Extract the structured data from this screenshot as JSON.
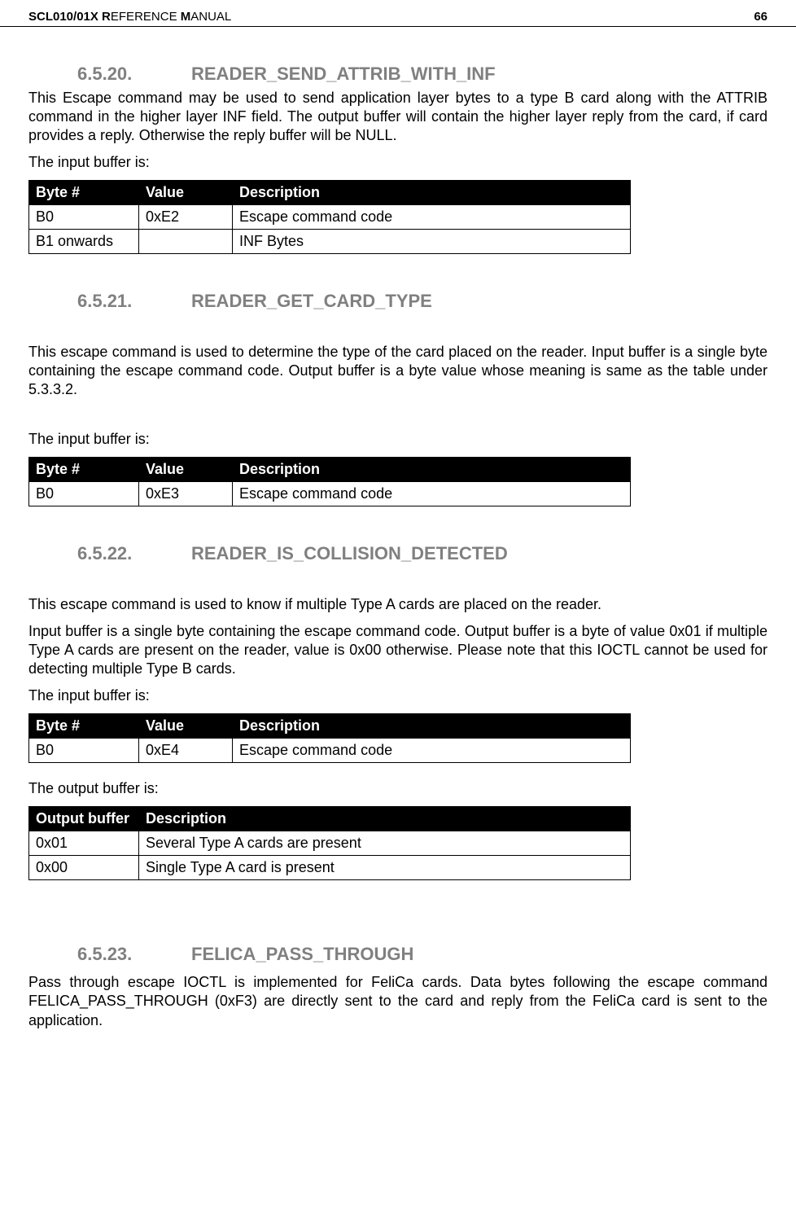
{
  "header": {
    "title_bold": "SCL010/01X R",
    "title_caps": "EFERENCE ",
    "title_bold2": "M",
    "title_caps2": "ANUAL",
    "page_no": "66"
  },
  "sections": [
    {
      "num": "6.5.20.",
      "title": "READER_SEND_ATTRIB_WITH_INF",
      "paragraphs": [
        "This Escape command may be used to send application layer bytes to a type B card along with the ATTRIB command in the higher layer INF field. The output buffer will contain the higher layer reply from the card, if card provides a reply. Otherwise the reply buffer will be NULL.",
        "The input buffer is:"
      ],
      "table": {
        "headers": [
          "Byte #",
          "Value",
          "Description"
        ],
        "rows": [
          [
            "B0",
            "0xE2",
            "Escape command code"
          ],
          [
            "B1 onwards",
            "",
            "INF Bytes"
          ]
        ]
      }
    },
    {
      "num": "6.5.21.",
      "title": "READER_GET_CARD_TYPE",
      "pre_space": true,
      "paragraphs": [
        "This escape command is used to determine the type of the card placed on the reader. Input buffer is a single byte containing the escape command code. Output buffer is a byte value whose meaning is same as the table under 5.3.3.2."
      ],
      "mid_space": true,
      "paragraphs2": [
        "The input buffer is:"
      ],
      "table": {
        "headers": [
          "Byte #",
          "Value",
          "Description"
        ],
        "rows": [
          [
            "B0",
            "0xE3",
            "Escape command code"
          ]
        ]
      }
    },
    {
      "num": "6.5.22.",
      "title": "READER_IS_COLLISION_DETECTED",
      "pre_space": true,
      "paragraphs": [
        "This escape command is used to know if multiple Type A cards are placed on the reader.",
        "Input buffer is a single byte containing the escape command code. Output buffer is a byte of value 0x01 if multiple Type A cards are present on the reader, value is 0x00 otherwise. Please note that this IOCTL cannot be used for detecting multiple Type B cards.",
        "The input buffer is:"
      ],
      "table": {
        "headers": [
          "Byte #",
          "Value",
          "Description"
        ],
        "rows": [
          [
            "B0",
            "0xE4",
            "Escape command code"
          ]
        ]
      },
      "paragraphs2": [
        "The output buffer is:"
      ],
      "table2": {
        "headers": [
          "Output buffer",
          "Description"
        ],
        "rows": [
          [
            "0x01",
            "Several Type A cards are present"
          ],
          [
            "0x00",
            "Single Type A card is present"
          ]
        ]
      }
    },
    {
      "num": "6.5.23.",
      "title": "FELICA_PASS_THROUGH",
      "big_space": true,
      "paragraphs": [
        "Pass through escape IOCTL is implemented for FeliCa cards. Data bytes following the escape command FELICA_PASS_THROUGH (0xF3) are directly sent to the card and reply from the FeliCa card is sent to the application."
      ]
    }
  ]
}
